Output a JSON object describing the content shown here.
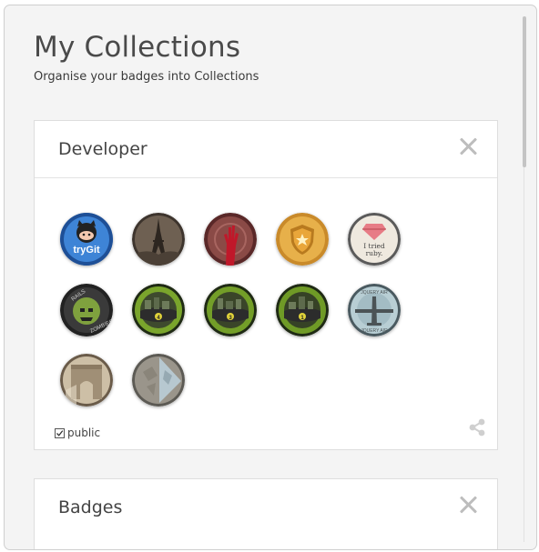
{
  "header": {
    "title": "My Collections",
    "subtitle": "Organise your badges into Collections"
  },
  "collections": [
    {
      "title": "Developer",
      "public_label": "public",
      "public_checked": true,
      "badges": [
        {
          "name": "tryGit",
          "icon": "octocat-icon",
          "text": "tryGit",
          "color": "#3a79c9"
        },
        {
          "name": "eiffel-tower",
          "icon": "tower-icon",
          "color": "#6b5d52"
        },
        {
          "name": "red-hand",
          "icon": "hand-icon",
          "color": "#7a3a3a"
        },
        {
          "name": "gold-shield",
          "icon": "shield-icon",
          "color": "#d9a53a"
        },
        {
          "name": "tried-ruby",
          "icon": "ruby-icon",
          "text": "I tried ruby.",
          "color": "#e8e2d8"
        },
        {
          "name": "rails-for-zombies",
          "icon": "zombie-icon",
          "text": "RAILS FOR ZOMBIES",
          "color": "#3c4a33"
        },
        {
          "name": "level-4",
          "icon": "road-icon",
          "text": "4",
          "color": "#5a7a2a"
        },
        {
          "name": "level-3",
          "icon": "road-icon",
          "text": "3",
          "color": "#4f6f25"
        },
        {
          "name": "level-1",
          "icon": "road-icon",
          "text": "1",
          "color": "#4a6a22"
        },
        {
          "name": "jquery-air",
          "icon": "plane-icon",
          "text": "JQUERY AIR",
          "color": "#a9c1c8"
        },
        {
          "name": "arc",
          "icon": "arch-icon",
          "color": "#a89882"
        },
        {
          "name": "map",
          "icon": "map-icon",
          "color": "#8d8d86"
        }
      ]
    },
    {
      "title": "Badges"
    }
  ]
}
